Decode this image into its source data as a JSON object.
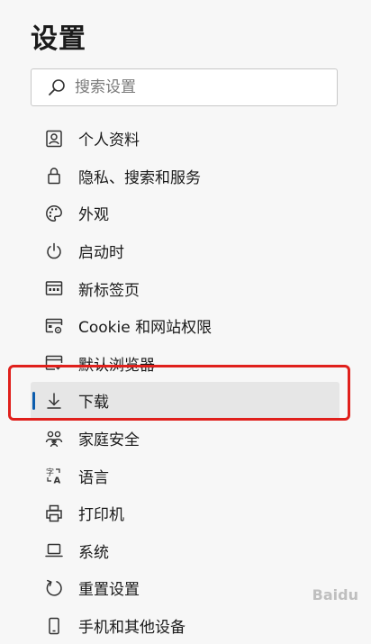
{
  "page": {
    "title": "设置"
  },
  "search": {
    "placeholder": "搜索设置"
  },
  "menu": {
    "selected_index": 7,
    "items": [
      {
        "label": "个人资料",
        "icon": "profile-icon"
      },
      {
        "label": "隐私、搜索和服务",
        "icon": "lock-icon"
      },
      {
        "label": "外观",
        "icon": "palette-icon"
      },
      {
        "label": "启动时",
        "icon": "power-icon"
      },
      {
        "label": "新标签页",
        "icon": "new-tab-icon"
      },
      {
        "label": "Cookie 和网站权限",
        "icon": "site-permissions-icon"
      },
      {
        "label": "默认浏览器",
        "icon": "default-browser-icon"
      },
      {
        "label": "下载",
        "icon": "download-icon"
      },
      {
        "label": "家庭安全",
        "icon": "family-icon"
      },
      {
        "label": "语言",
        "icon": "language-icon"
      },
      {
        "label": "打印机",
        "icon": "printer-icon"
      },
      {
        "label": "系统",
        "icon": "system-icon"
      },
      {
        "label": "重置设置",
        "icon": "reset-icon"
      },
      {
        "label": "手机和其他设备",
        "icon": "phone-icon"
      }
    ]
  },
  "watermark": {
    "text": "Baidu"
  },
  "colors": {
    "accent": "#0b5cad",
    "highlight": "#e0201c",
    "background": "#f7f7f7",
    "selected_bg": "#e6e6e6"
  }
}
